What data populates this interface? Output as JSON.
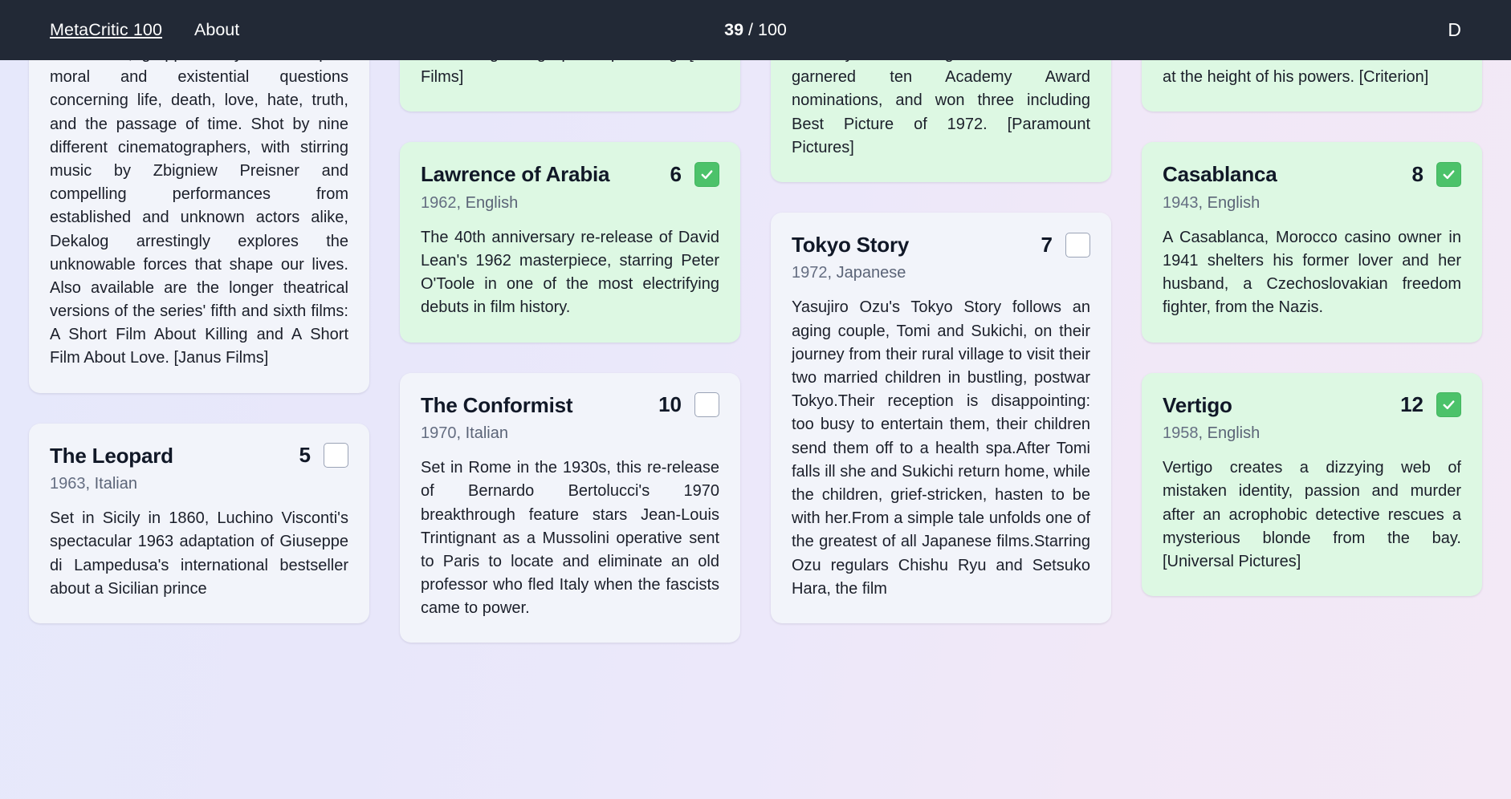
{
  "navbar": {
    "brand": "MetaCritic 100",
    "about_label": "About",
    "counter_current": "39",
    "counter_separator": " / ",
    "counter_total": "100",
    "avatar_initial": "D",
    "background_color": "#222936"
  },
  "theme": {
    "card_default_bg": "#f2f4fa",
    "card_seen_bg": "#ddf8e3",
    "checkbox_checked_bg": "#4cc26a",
    "checkbox_border": "#9aa3b6",
    "page_gradient_start": "#e6e8fb",
    "page_gradient_end": "#f3e9f6"
  },
  "columns": [
    {
      "cards": [
        {
          "title": "",
          "rank": "",
          "seen": false,
          "clipped_top": true,
          "meta_year": "",
          "meta_language": "",
          "body": "…structure, grapple deftly with complex moral and existential questions concerning life, death, love, hate, truth, and the passage of time. Shot by nine different cinematographers, with stirring music by Zbigniew Preisner and compelling performances from established and unknown actors alike, Dekalog arrestingly explores the unknowable forces that shape our lives. Also available are the longer theatrical versions of the series' fifth and sixth films: A Short Film About Killing and A Short Film About Love. [Janus Films]"
        },
        {
          "title": "The Leopard",
          "rank": "5",
          "seen": false,
          "clipped_top": false,
          "meta_year": "1963",
          "meta_language": "Italian",
          "body": "Set in Sicily in 1860, Luchino Visconti's spectacular 1963 adaptation of Giuseppe di Lampedusa's international bestseller about a Sicilian prince"
        }
      ]
    },
    {
      "cards": [
        {
          "title": "",
          "rank": "",
          "seen": true,
          "clipped_top": true,
          "meta_year": "",
          "meta_language": "",
          "body": "…ous to growing up and parenting. [IFC Films]"
        },
        {
          "title": "Lawrence of Arabia",
          "rank": "6",
          "seen": true,
          "clipped_top": false,
          "meta_year": "1962",
          "meta_language": "English",
          "body": "The 40th anniversary re-release of David Lean's 1962 masterpiece, starring Peter O'Toole in one of the most electrifying debuts in film history."
        },
        {
          "title": "The Conformist",
          "rank": "10",
          "seen": false,
          "clipped_top": false,
          "meta_year": "1970",
          "meta_language": "Italian",
          "body": "Set in Rome in the 1930s, this re-release of Bernardo Bertolucci's 1970 breakthrough feature stars Jean-Louis Trintignant as a Mussolini operative sent to Paris to locate and eliminate an old professor who fled Italy when the fascists came to power."
        }
      ]
    },
    {
      "cards": [
        {
          "title": "",
          "rank": "",
          "seen": true,
          "clipped_top": true,
          "meta_year": "",
          "meta_language": "",
          "body": "…Darkly this soaring and brilliant film garnered ten Academy Award nominations, and won three including Best Picture of 1972. [Paramount Pictures]"
        },
        {
          "title": "Tokyo Story",
          "rank": "7",
          "seen": false,
          "clipped_top": false,
          "meta_year": "1972",
          "meta_language": "Japanese",
          "body": "Yasujiro Ozu's Tokyo Story follows an aging couple, Tomi and Sukichi, on their journey from their rural village to visit their two married children in bustling, postwar Tokyo.Their reception is disappointing: too busy to entertain them, their children send them off to a health spa.After Tomi falls ill she and Sukichi return home, while the children, grief-stricken, hasten to be with her.From a simple tale unfolds one of the greatest of all Japanese films.Starring Ozu regulars Chishu Ryu and Setsuko Hara, the film"
        }
      ]
    },
    {
      "cards": [
        {
          "title": "",
          "rank": "",
          "seen": true,
          "clipped_top": true,
          "meta_year": "",
          "meta_language": "",
          "body": "…statement from a remarkable filmmaker at the height of his powers. [Criterion]"
        },
        {
          "title": "Casablanca",
          "rank": "8",
          "seen": true,
          "clipped_top": false,
          "meta_year": "1943",
          "meta_language": "English",
          "body": "A Casablanca, Morocco casino owner in 1941 shelters his former lover and her husband, a Czechoslovakian freedom fighter, from the Nazis."
        },
        {
          "title": "Vertigo",
          "rank": "12",
          "seen": true,
          "clipped_top": false,
          "meta_year": "1958",
          "meta_language": "English",
          "body": "Vertigo creates a dizzying web of mistaken identity, passion and murder after an acrophobic detective rescues a mysterious blonde from the bay. [Universal Pictures]"
        }
      ]
    }
  ]
}
